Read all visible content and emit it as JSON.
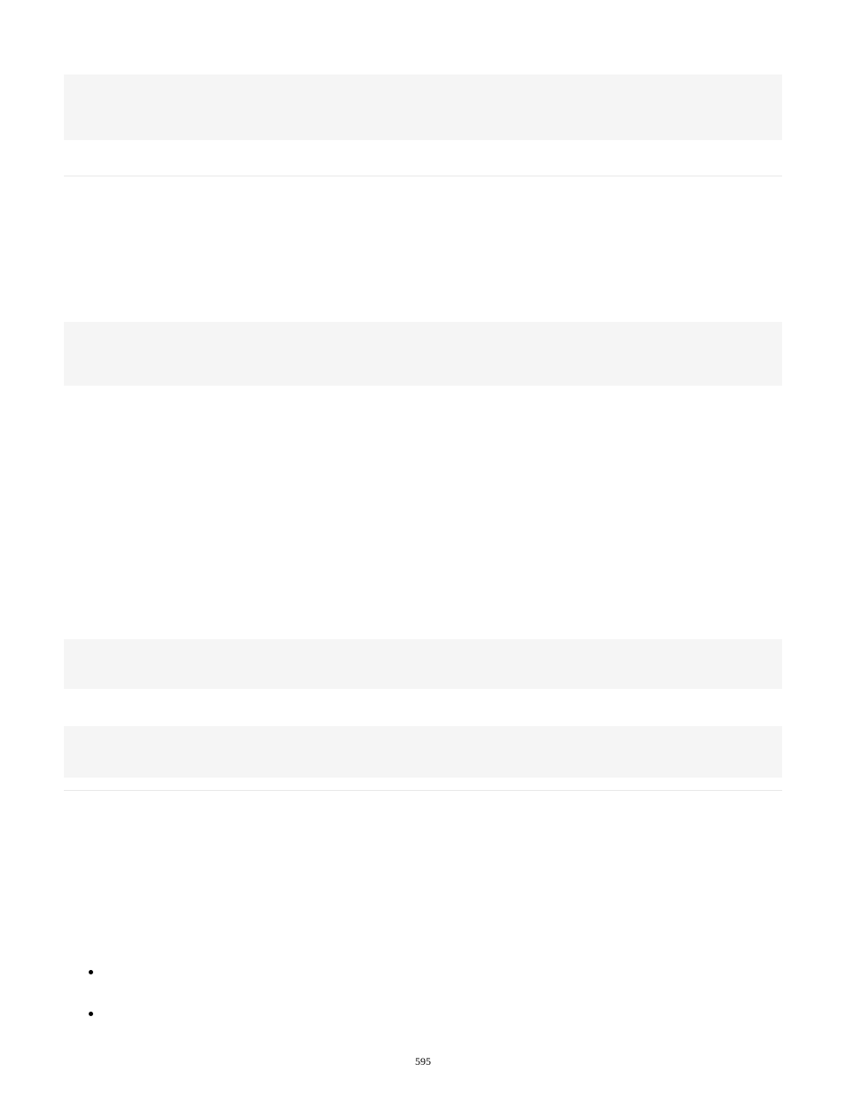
{
  "page": {
    "number": "595",
    "bullets": [
      {
        "text": ""
      },
      {
        "text": ""
      }
    ]
  }
}
